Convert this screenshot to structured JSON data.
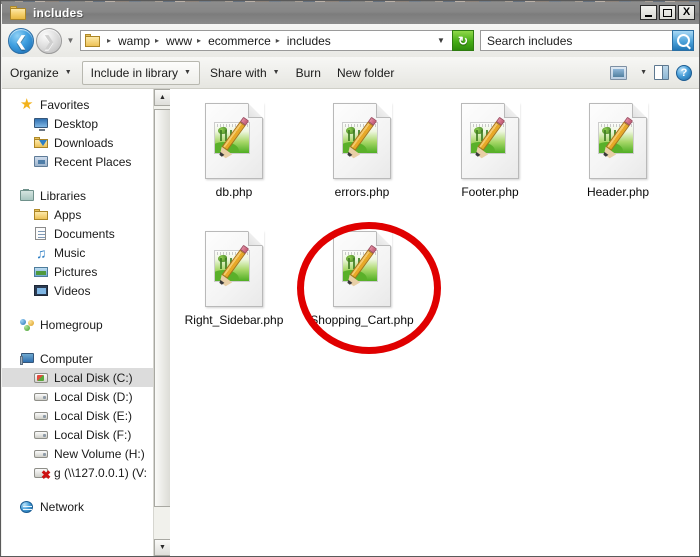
{
  "window": {
    "title": "includes",
    "title_icon": "folder-icon",
    "buttons": {
      "minimize": "minimize-button",
      "maximize": "maximize-button",
      "close": "close-button",
      "close_glyph": "X"
    }
  },
  "address_bar": {
    "back_label": "Back",
    "forward_label": "Forward",
    "history_dropdown": "Recent locations",
    "crumb_icon": "folder-icon",
    "breadcrumbs": [
      "wamp",
      "www",
      "ecommerce",
      "includes"
    ],
    "separator": "▸",
    "path_dropdown": "Previous locations",
    "refresh_label": "Refresh",
    "refresh_glyph": "↻",
    "search_placeholder": "Search includes",
    "search_value": "",
    "search_button": "search-icon"
  },
  "toolbar": {
    "items": [
      {
        "label": "Organize",
        "caret": true,
        "boxed": false
      },
      {
        "label": "Include in library",
        "caret": true,
        "boxed": true
      },
      {
        "label": "Share with",
        "caret": true,
        "boxed": false
      },
      {
        "label": "Burn",
        "caret": false,
        "boxed": false
      },
      {
        "label": "New folder",
        "caret": false,
        "boxed": false
      }
    ],
    "right_icons": [
      {
        "name": "change-view-icon"
      },
      {
        "name": "view-dropdown-caret"
      },
      {
        "name": "preview-pane-icon"
      },
      {
        "name": "help-icon",
        "glyph": "?"
      }
    ]
  },
  "navigation_pane": {
    "groups": [
      {
        "header": {
          "label": "Favorites",
          "icon": "star-icon"
        },
        "items": [
          {
            "label": "Desktop",
            "icon": "desktop-icon"
          },
          {
            "label": "Downloads",
            "icon": "downloads-folder-icon"
          },
          {
            "label": "Recent Places",
            "icon": "recent-places-icon"
          }
        ]
      },
      {
        "header": {
          "label": "Libraries",
          "icon": "libraries-icon"
        },
        "items": [
          {
            "label": "Apps",
            "icon": "folder-icon"
          },
          {
            "label": "Documents",
            "icon": "documents-library-icon"
          },
          {
            "label": "Music",
            "icon": "music-library-icon"
          },
          {
            "label": "Pictures",
            "icon": "pictures-library-icon"
          },
          {
            "label": "Videos",
            "icon": "videos-library-icon"
          }
        ]
      },
      {
        "header": {
          "label": "Homegroup",
          "icon": "homegroup-icon"
        },
        "items": []
      },
      {
        "header": {
          "label": "Computer",
          "icon": "computer-icon"
        },
        "items": [
          {
            "label": "Local Disk (C:)",
            "icon": "windows-drive-icon",
            "selected": true
          },
          {
            "label": "Local Disk (D:)",
            "icon": "drive-icon",
            "selected": false
          },
          {
            "label": "Local Disk (E:)",
            "icon": "drive-icon",
            "selected": false
          },
          {
            "label": "Local Disk (F:)",
            "icon": "drive-icon",
            "selected": false
          },
          {
            "label": "New Volume (H:)",
            "icon": "drive-icon",
            "selected": false
          },
          {
            "label": "g (\\\\127.0.0.1) (V:",
            "icon": "disconnected-network-drive-icon",
            "selected": false
          }
        ]
      },
      {
        "header": {
          "label": "Network",
          "icon": "network-icon"
        },
        "items": []
      }
    ],
    "scrollbar": {
      "up": "▲",
      "down": "▼"
    }
  },
  "file_list": {
    "view": "Large icons",
    "files": [
      {
        "name": "db.php",
        "icon": "php-file-icon"
      },
      {
        "name": "errors.php",
        "icon": "php-file-icon"
      },
      {
        "name": "Footer.php",
        "icon": "php-file-icon"
      },
      {
        "name": "Header.php",
        "icon": "php-file-icon"
      },
      {
        "name": "Right_Sidebar.php",
        "icon": "php-file-icon"
      },
      {
        "name": "Shopping_Cart.php",
        "icon": "php-file-icon",
        "annotated": true
      }
    ]
  },
  "annotation": {
    "shape": "ellipse",
    "color": "#e00000",
    "target": "Shopping_Cart.php"
  }
}
